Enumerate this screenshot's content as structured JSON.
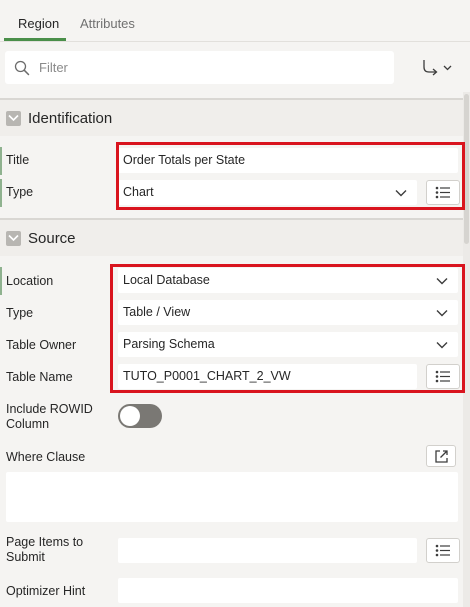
{
  "tabs": [
    {
      "label": "Region",
      "active": true
    },
    {
      "label": "Attributes",
      "active": false
    }
  ],
  "filter": {
    "placeholder": "Filter",
    "value": ""
  },
  "identification": {
    "title": "Identification",
    "title_label": "Title",
    "title_value": "Order Totals per State",
    "type_label": "Type",
    "type_value": "Chart"
  },
  "source": {
    "title": "Source",
    "location_label": "Location",
    "location_value": "Local Database",
    "type_label": "Type",
    "type_value": "Table / View",
    "table_owner_label": "Table Owner",
    "table_owner_value": "Parsing Schema",
    "table_name_label": "Table Name",
    "table_name_value": "TUTO_P0001_CHART_2_VW",
    "include_rowid_label_1": "Include ROWID",
    "include_rowid_label_2": "Column",
    "include_rowid_value": false,
    "where_clause_label": "Where Clause",
    "where_clause_value": "",
    "page_items_label_1": "Page Items to",
    "page_items_label_2": "Submit",
    "page_items_value": "",
    "optimizer_hint_label": "Optimizer Hint",
    "optimizer_hint_value": ""
  },
  "colors": {
    "highlight": "#d9141e",
    "active_tab_underline": "#4a8f4a",
    "required_marker": "#8fb28f"
  }
}
